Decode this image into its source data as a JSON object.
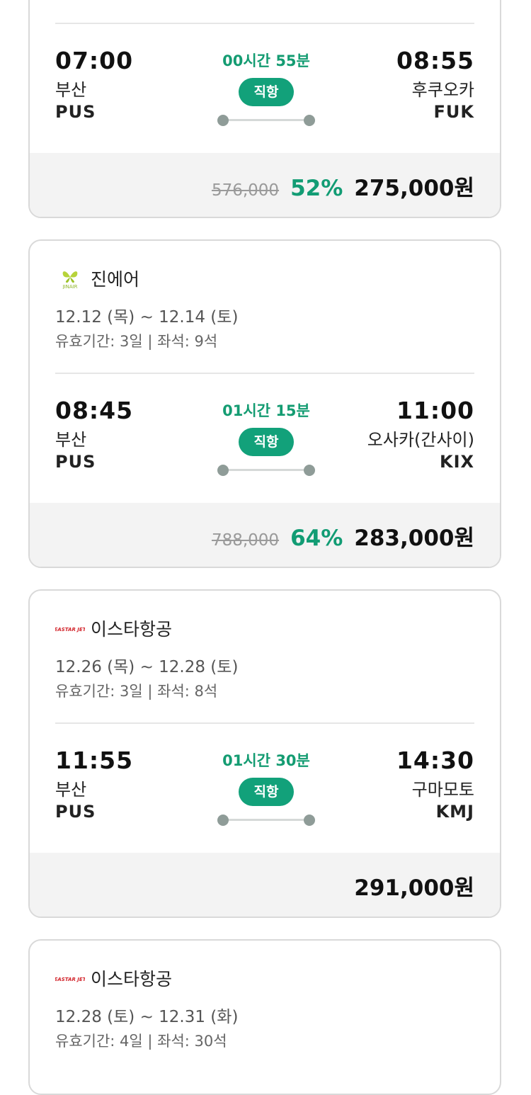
{
  "cards": [
    {
      "airline": "",
      "dates": "",
      "meta": "",
      "flight": {
        "dep_time": "07:00",
        "dep_city": "부산",
        "dep_code": "PUS",
        "duration": "00시간 55분",
        "badge": "직항",
        "arr_time": "08:55",
        "arr_city": "후쿠오카",
        "arr_code": "FUK"
      },
      "price": {
        "original": "576,000",
        "discount": "52%",
        "final": "275,000원"
      }
    },
    {
      "airline": "진에어",
      "logo": "jinair-logo",
      "dates": "12.12 (목) ~ 12.14 (토)",
      "meta": "유효기간: 3일 | 좌석: 9석",
      "flight": {
        "dep_time": "08:45",
        "dep_city": "부산",
        "dep_code": "PUS",
        "duration": "01시간 15분",
        "badge": "직항",
        "arr_time": "11:00",
        "arr_city": "오사카(간사이)",
        "arr_code": "KIX"
      },
      "price": {
        "original": "788,000",
        "discount": "64%",
        "final": "283,000원"
      }
    },
    {
      "airline": "이스타항공",
      "logo": "eastarjet-logo",
      "dates": "12.26 (목) ~ 12.28 (토)",
      "meta": "유효기간: 3일 | 좌석: 8석",
      "flight": {
        "dep_time": "11:55",
        "dep_city": "부산",
        "dep_code": "PUS",
        "duration": "01시간 30분",
        "badge": "직항",
        "arr_time": "14:30",
        "arr_city": "구마모토",
        "arr_code": "KMJ"
      },
      "price": {
        "original": "",
        "discount": "",
        "final": "291,000원"
      }
    },
    {
      "airline": "이스타항공",
      "logo": "eastarjet-logo",
      "dates": "12.28 (토) ~ 12.31 (화)",
      "meta": "유효기간: 4일 | 좌석: 30석"
    }
  ],
  "colors": {
    "accent_green": "#12a17a",
    "discount_green": "#129c74",
    "price_bg": "#f3f3f3",
    "card_border": "#d9d9d9"
  }
}
